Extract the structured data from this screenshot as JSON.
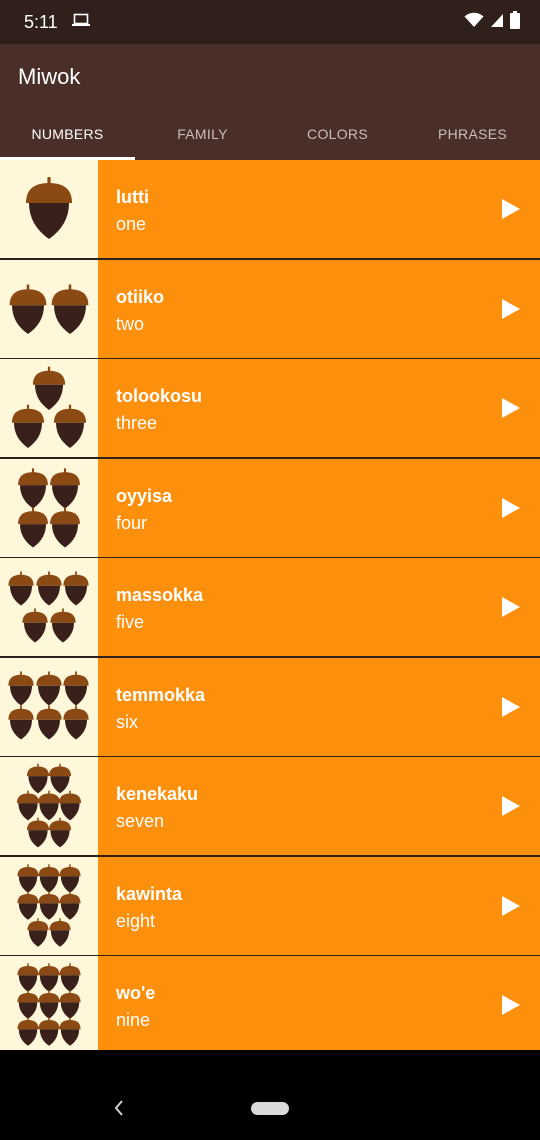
{
  "status_bar": {
    "time": "5:11"
  },
  "app_bar": {
    "title": "Miwok"
  },
  "tabs": [
    {
      "label": "NUMBERS",
      "active": true
    },
    {
      "label": "FAMILY",
      "active": false
    },
    {
      "label": "COLORS",
      "active": false
    },
    {
      "label": "PHRASES",
      "active": false
    }
  ],
  "words": [
    {
      "miwok": "lutti",
      "english": "one",
      "count": 1
    },
    {
      "miwok": "otiiko",
      "english": "two",
      "count": 2
    },
    {
      "miwok": "tolookosu",
      "english": "three",
      "count": 3
    },
    {
      "miwok": "oyyisa",
      "english": "four",
      "count": 4
    },
    {
      "miwok": "massokka",
      "english": "five",
      "count": 5
    },
    {
      "miwok": "temmokka",
      "english": "six",
      "count": 6
    },
    {
      "miwok": "kenekaku",
      "english": "seven",
      "count": 7
    },
    {
      "miwok": "kawinta",
      "english": "eight",
      "count": 8
    },
    {
      "miwok": "wo'e",
      "english": "nine",
      "count": 9
    }
  ],
  "colors": {
    "status_bar": "#2F201B",
    "app_bar": "#4A2F29",
    "row_background": "#FC8F0C",
    "image_background": "#FFF7DA",
    "acorn_cap": "#8B4A14",
    "acorn_body": "#3A201A"
  },
  "icons": {
    "row_icon": "acorn-icon",
    "row_action": "play-icon",
    "nav_back": "back-icon",
    "nav_home": "home-pill"
  }
}
